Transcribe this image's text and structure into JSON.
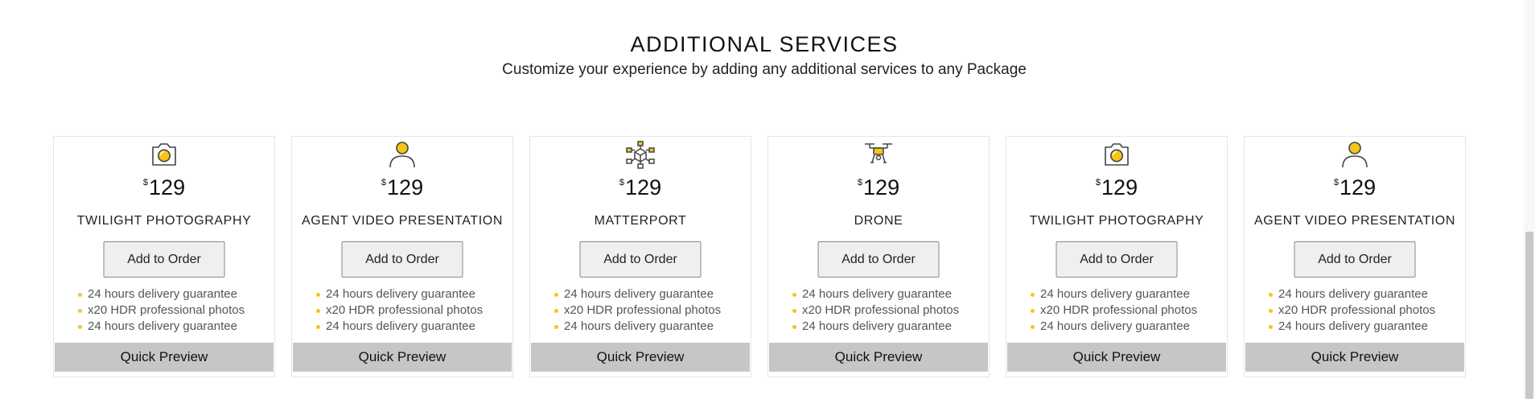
{
  "section": {
    "title": "ADDITIONAL SERVICES",
    "subtitle": "Customize your experience by adding any additional services to any Package"
  },
  "colors": {
    "accent": "#f5c518",
    "preview_bg": "#c6c6c6",
    "button_bg": "#efefef"
  },
  "cards": [
    {
      "icon": "camera-icon",
      "currency": "$",
      "price": "129",
      "name": "TWILIGHT PHOTOGRAPHY",
      "add_label": "Add to Order",
      "features": [
        "24 hours delivery guarantee",
        "x20 HDR professional photos",
        "24 hours delivery guarantee"
      ],
      "preview_label": "Quick Preview"
    },
    {
      "icon": "person-icon",
      "currency": "$",
      "price": "129",
      "name": "AGENT VIDEO PRESENTATION",
      "add_label": "Add to Order",
      "features": [
        "24 hours delivery guarantee",
        "x20 HDR professional photos",
        "24 hours delivery guarantee"
      ],
      "preview_label": "Quick Preview"
    },
    {
      "icon": "cube-network-icon",
      "currency": "$",
      "price": "129",
      "name": "MATTERPORT",
      "add_label": "Add to Order",
      "features": [
        "24 hours delivery guarantee",
        "x20 HDR professional photos",
        "24 hours delivery guarantee"
      ],
      "preview_label": "Quick Preview"
    },
    {
      "icon": "drone-icon",
      "currency": "$",
      "price": "129",
      "name": "DRONE",
      "add_label": "Add to Order",
      "features": [
        "24 hours delivery guarantee",
        "x20 HDR professional photos",
        "24 hours delivery guarantee"
      ],
      "preview_label": "Quick Preview"
    },
    {
      "icon": "camera-icon",
      "currency": "$",
      "price": "129",
      "name": "TWILIGHT PHOTOGRAPHY",
      "add_label": "Add to Order",
      "features": [
        "24 hours delivery guarantee",
        "x20 HDR professional photos",
        "24 hours delivery guarantee"
      ],
      "preview_label": "Quick Preview"
    },
    {
      "icon": "person-icon",
      "currency": "$",
      "price": "129",
      "name": "AGENT VIDEO PRESENTATION",
      "add_label": "Add to Order",
      "features": [
        "24 hours delivery guarantee",
        "x20 HDR professional photos",
        "24 hours delivery guarantee"
      ],
      "preview_label": "Quick Preview"
    }
  ]
}
